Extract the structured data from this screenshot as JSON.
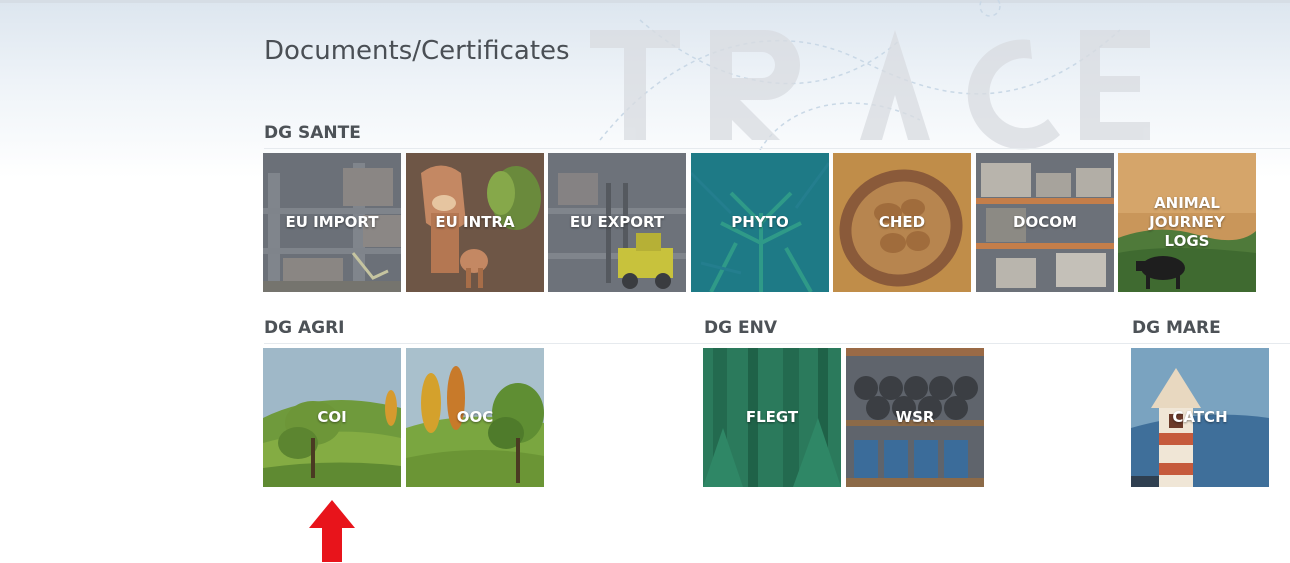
{
  "page_title": "Documents/Certificates",
  "watermark_text": "TRACES",
  "sections": {
    "dg_sante": {
      "title": "DG SANTE",
      "tiles": {
        "eu_import": "EU IMPORT",
        "eu_intra": "EU INTRA",
        "eu_export": "EU EXPORT",
        "phyto": "PHYTO",
        "ched": "CHED",
        "docom": "DOCOM",
        "animal_journey_logs": "ANIMAL\nJOURNEY\nLOGS"
      }
    },
    "dg_agri": {
      "title": "DG AGRI",
      "tiles": {
        "coi": "COI",
        "ooc": "OOC"
      }
    },
    "dg_env": {
      "title": "DG ENV",
      "tiles": {
        "flegt": "FLEGT",
        "wsr": "WSR"
      }
    },
    "dg_mare": {
      "title": "DG MARE",
      "tiles": {
        "catch": "CATCH"
      }
    }
  },
  "colors": {
    "title_text": "#4a4f55",
    "tile_label": "#ffffff",
    "arrow": "#e8141b"
  },
  "icons": {
    "pointer": "red-arrow-up-icon"
  }
}
